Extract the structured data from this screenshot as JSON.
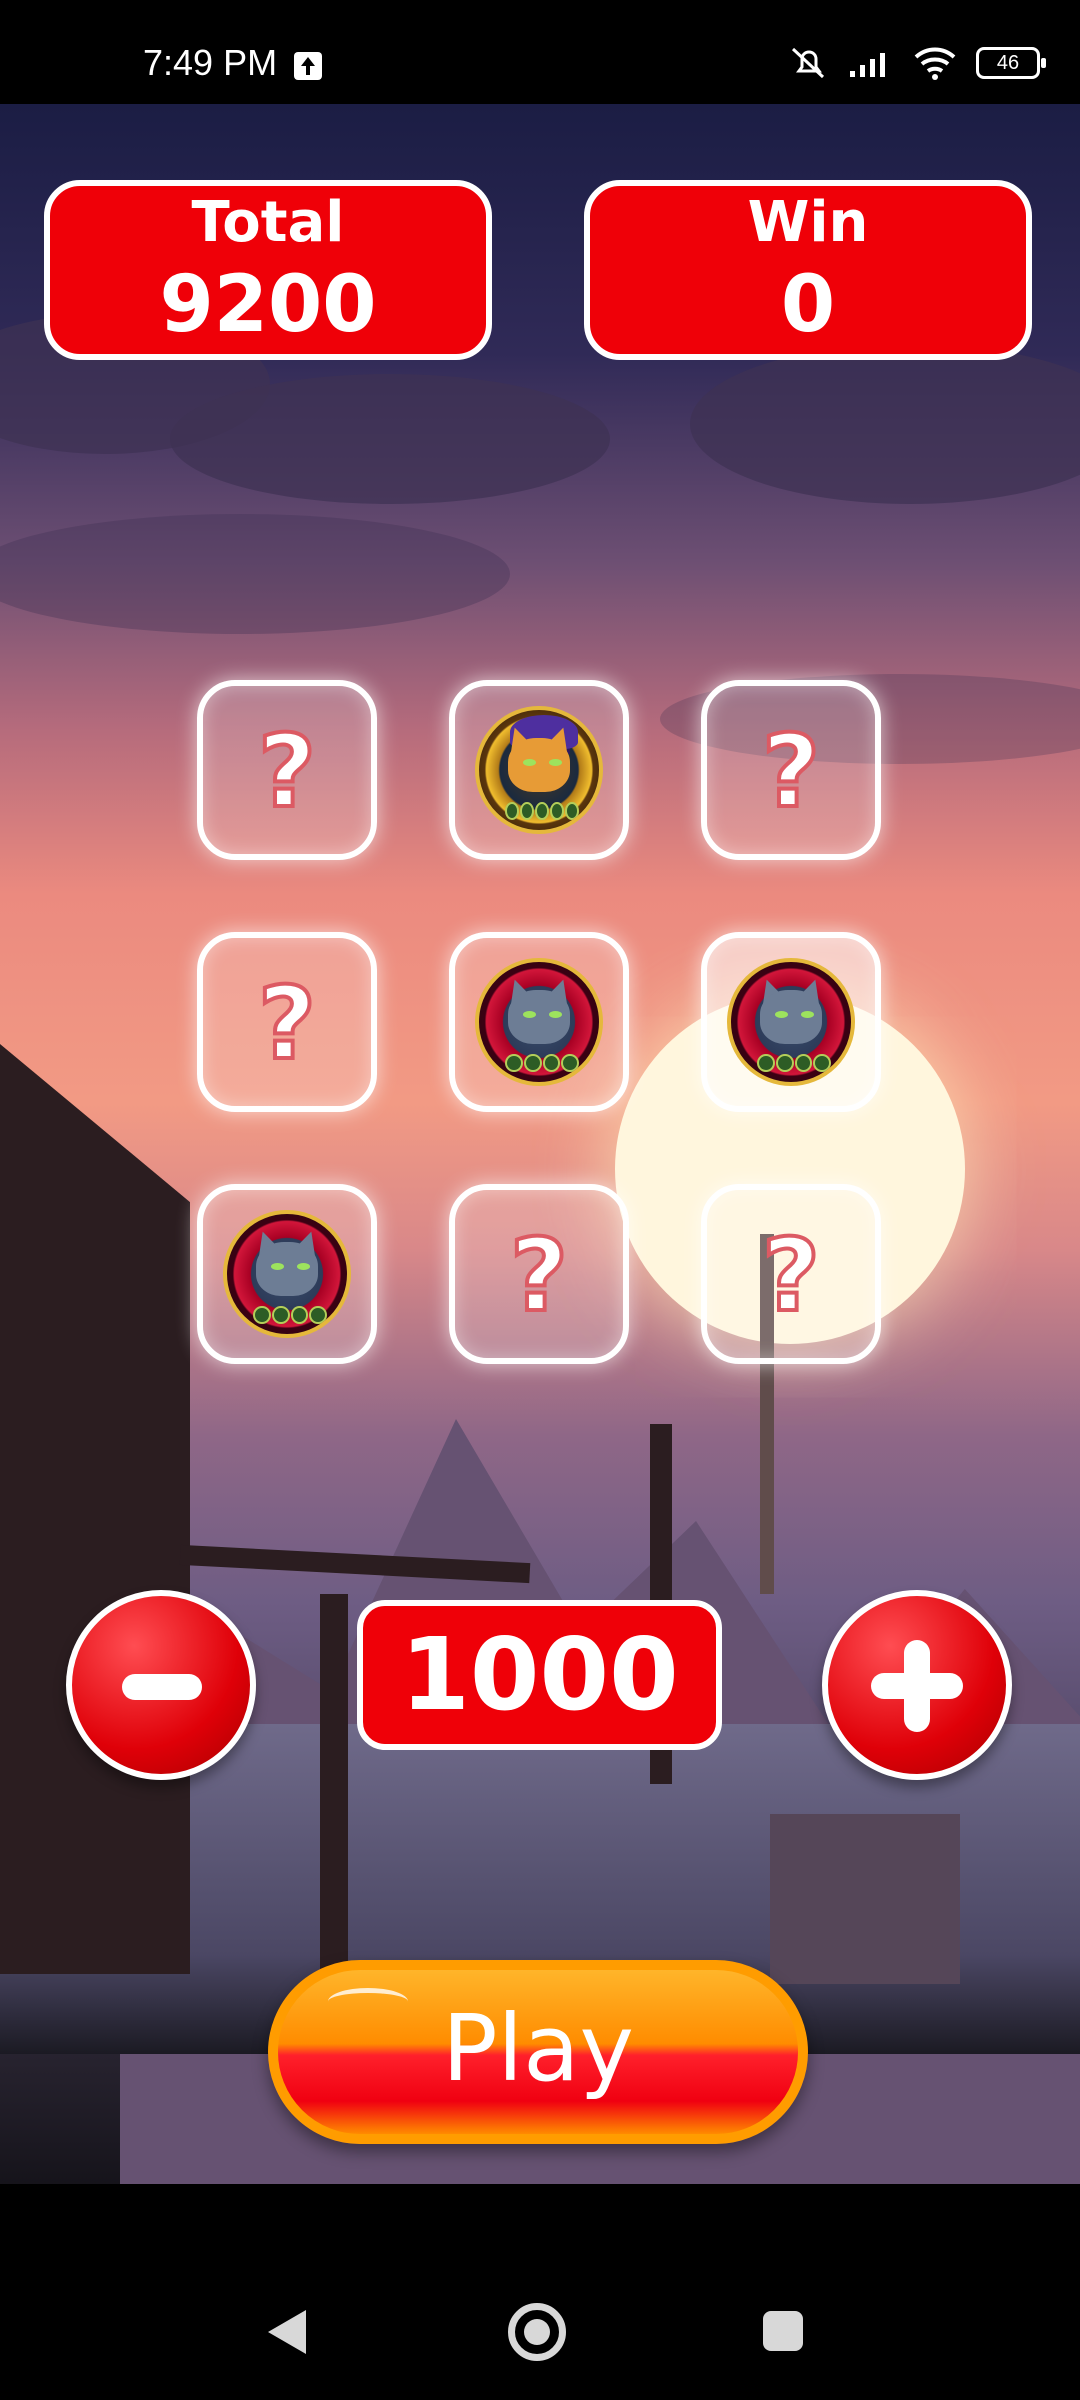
{
  "status": {
    "time": "7:49 PM",
    "battery": "46",
    "icons": [
      "upload-icon",
      "muted-bell-icon",
      "signal-icon",
      "wifi-icon",
      "battery-icon"
    ]
  },
  "scoreboard": {
    "total_label": "Total",
    "total_value": "9200",
    "win_label": "Win",
    "win_value": "0"
  },
  "grid": {
    "tiles": [
      {
        "state": "hidden",
        "symbol": "?",
        "icon": "question-mark-icon"
      },
      {
        "state": "revealed",
        "icon": "gold-cat-coin-icon"
      },
      {
        "state": "hidden",
        "symbol": "?",
        "icon": "question-mark-icon"
      },
      {
        "state": "hidden",
        "symbol": "?",
        "icon": "question-mark-icon"
      },
      {
        "state": "revealed",
        "icon": "gray-cat-coin-icon"
      },
      {
        "state": "revealed",
        "icon": "gray-cat-coin-icon"
      },
      {
        "state": "revealed",
        "icon": "gray-cat-coin-icon"
      },
      {
        "state": "hidden",
        "symbol": "?",
        "icon": "question-mark-icon"
      },
      {
        "state": "hidden",
        "symbol": "?",
        "icon": "question-mark-icon"
      }
    ]
  },
  "controls": {
    "bet_value": "1000",
    "decrease_icon": "minus-icon",
    "increase_icon": "plus-icon",
    "play_label": "Play"
  },
  "navigation": {
    "back_icon": "back-icon",
    "home_icon": "home-icon",
    "recent_icon": "recent-apps-icon"
  },
  "colors": {
    "accent": "#ef0008",
    "play_orange": "#ff9c00",
    "text": "#ffffff"
  }
}
